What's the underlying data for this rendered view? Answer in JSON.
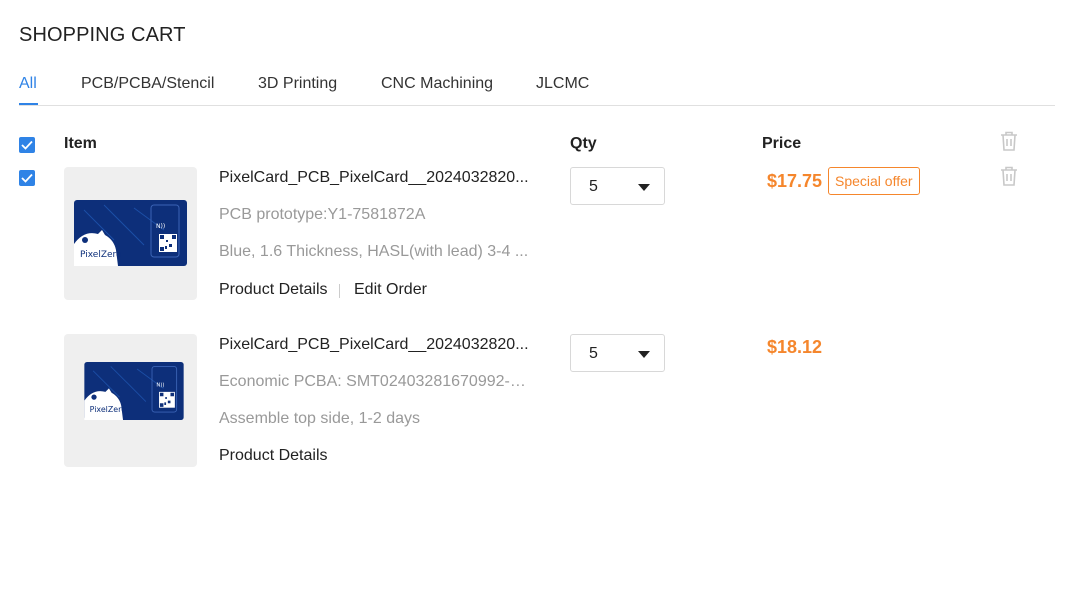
{
  "page": {
    "title": "SHOPPING CART"
  },
  "tabs": [
    {
      "label": "All",
      "active": true
    },
    {
      "label": "PCB/PCBA/Stencil"
    },
    {
      "label": "3D Printing"
    },
    {
      "label": "CNC Machining"
    },
    {
      "label": "JLCMC"
    }
  ],
  "table_header": {
    "item": "Item",
    "qty": "Qty",
    "price": "Price"
  },
  "items": [
    {
      "name": "PixelCard_PCB_PixelCard__2024032820...",
      "line1": "PCB prototype:Y1-7581872A",
      "line2": "Blue, 1.6 Thickness, HASL(with lead) 3-4 ...",
      "details_link": "Product Details",
      "edit_link": "Edit Order",
      "qty": "5",
      "price": "$17.75",
      "badge": "Special offer",
      "checked": true
    },
    {
      "name": "PixelCard_PCB_PixelCard__2024032820...",
      "line1": "Economic PCBA: SMT02403281670992-7...",
      "line2": "Assemble top side, 1-2 days",
      "details_link": "Product Details",
      "qty": "5",
      "price": "$18.12"
    }
  ],
  "board_text": {
    "brand": "PixelZero",
    "nfc": "N))"
  },
  "colors": {
    "accent": "#2f83e6",
    "price": "#f5862c",
    "board": "#0d2f7a"
  }
}
